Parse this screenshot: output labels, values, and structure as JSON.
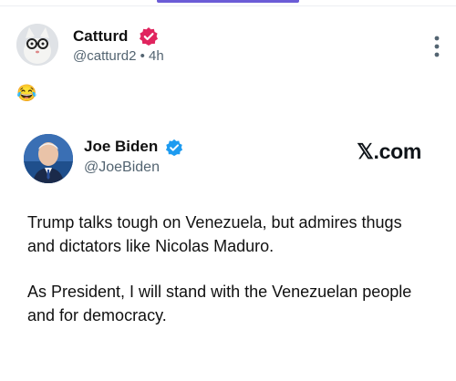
{
  "post": {
    "author_name": "Catturd",
    "author_handle": "@catturd2",
    "separator": "•",
    "time": "4h",
    "emoji": "😂",
    "badge_color": "#e0245e"
  },
  "embedded": {
    "author_name": "Joe Biden",
    "author_handle": "@JoeBiden",
    "badge_color": "#1d9bf0",
    "source": "𝕏.com",
    "paragraphs": [
      "Trump talks tough on Venezuela, but admires thugs and dictators like Nicolas Maduro.",
      "As President, I will stand with the Venezuelan people and for democracy."
    ]
  }
}
